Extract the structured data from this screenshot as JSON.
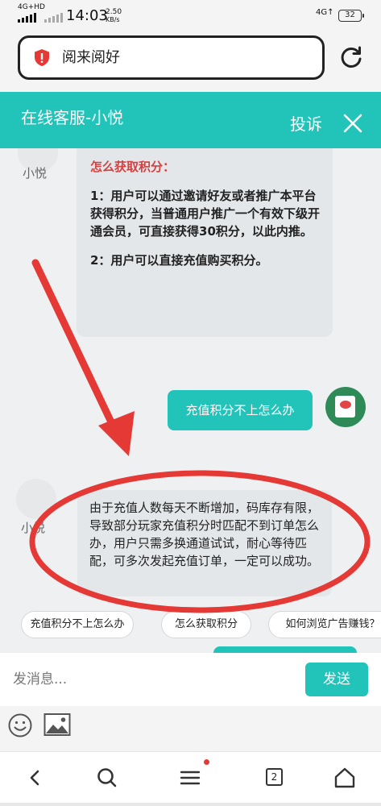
{
  "status_bar": {
    "network": "4G+HD",
    "time": "14:03",
    "speed_value": "2.50",
    "speed_unit": "KB/s",
    "network_right": "4G↑",
    "battery": "32"
  },
  "browser": {
    "url_title": "阅来阅好",
    "icons": [
      "shield-alert-icon",
      "reload-icon"
    ],
    "accent": "#e53935"
  },
  "chat": {
    "title": "在线客服-小悦",
    "complain_label": "投诉",
    "agent_name": "小悦",
    "theme_color": "#22c3b9",
    "messages": [
      {
        "from": "agent",
        "heading": "怎么获取积分：",
        "lines": [
          "1：用户可以通过邀请好友或者推广本平台获得积分，当普通用户推广一个有效下级开通会员，可直接获得30积分，以此内推。",
          "2：用户可以直接充值购买积分。"
        ]
      },
      {
        "from": "user",
        "text": "充值积分不上怎么办"
      },
      {
        "from": "agent",
        "text": "由于充值人数每天不断增加，码库存有限，导致部分玩家充值积分时匹配不到订单怎么办，用户只需多换通道试试，耐心等待匹配，可多次发起充值订单，一定可以成功。"
      }
    ],
    "quick_replies": [
      "充值积分不上怎么办",
      "怎么获取积分",
      "如何浏览广告赚钱？"
    ]
  },
  "composer": {
    "placeholder": "发消息...",
    "send_label": "发送",
    "tools": [
      "emoji-icon",
      "image-icon"
    ]
  },
  "nav": {
    "items": [
      "back-icon",
      "search-icon",
      "menu-icon",
      "tabs-icon",
      "home-icon"
    ],
    "tab_count": "2"
  },
  "annotation": {
    "color": "#e53935"
  }
}
